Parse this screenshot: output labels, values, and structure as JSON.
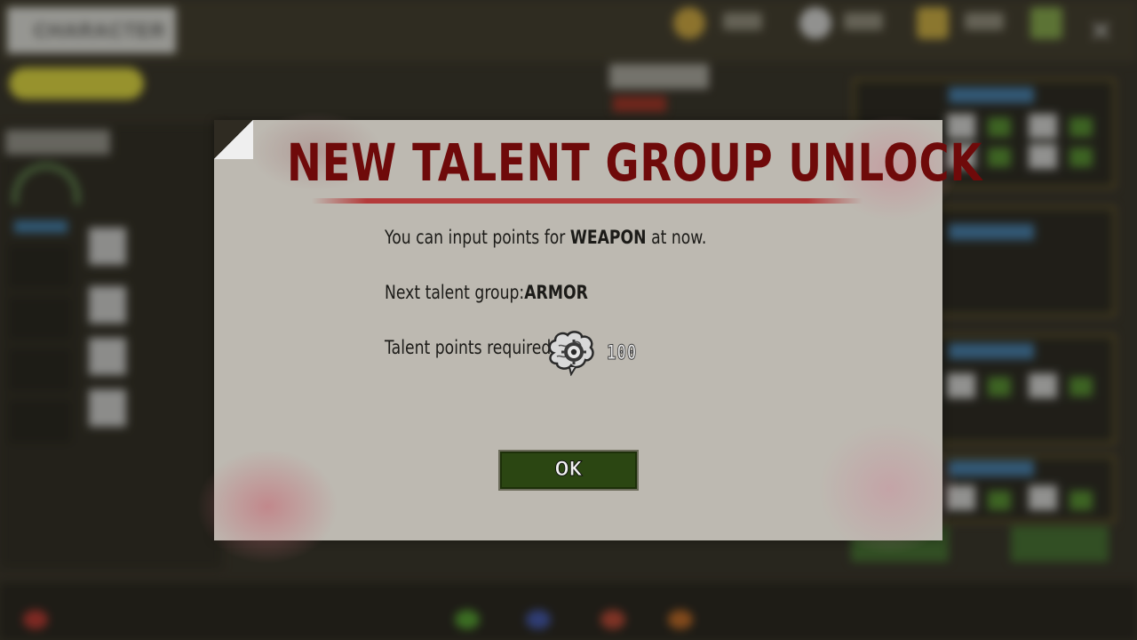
{
  "background": {
    "screen_title": "CHARACTER"
  },
  "dialog": {
    "title": "NEW TALENT GROUP UNLOCK",
    "line1_prefix": "You can input points for ",
    "line1_group": "WEAPON",
    "line1_suffix": " at now.",
    "line2_prefix": "Next talent group:",
    "line2_group": "ARMOR",
    "line3_label": "Talent points required:",
    "points_icon": "brain-gear-icon",
    "points_required": "100",
    "ok_label": "OK"
  },
  "colors": {
    "title": "#6f0a0a",
    "title_band": "#b43a3a",
    "panel": "#bdb9b1",
    "ok_button": "#2b4612"
  }
}
